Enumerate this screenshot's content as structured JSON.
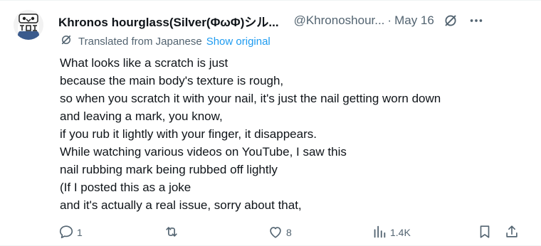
{
  "post": {
    "author_name": "Khronos hourglass(Silver(ΦωΦ)シル...",
    "author_handle": "@Khronoshour...",
    "separator": "·",
    "date": "May 16",
    "translation": {
      "label": "Translated from Japanese",
      "link": "Show original"
    },
    "lines": [
      "What looks like a scratch is just",
      "because the main body's texture is rough,",
      "so when you scratch it with your nail, it's just the nail getting worn down",
      "and leaving a mark, you know,",
      "if you rub it lightly with your finger, it disappears.",
      "While watching various videos on YouTube, I saw this",
      "nail rubbing mark being rubbed off lightly",
      "(If I posted this as a joke",
      "and it's actually a real issue, sorry about that,"
    ]
  },
  "actions": {
    "replies": "1",
    "reposts": "",
    "likes": "8",
    "views": "1.4K"
  },
  "icons": {
    "header": [
      "grok-icon",
      "more-icon"
    ],
    "translate": "grok-translate-icon",
    "actions": [
      "reply-icon",
      "repost-icon",
      "like-icon",
      "views-icon",
      "bookmark-icon",
      "share-icon"
    ]
  },
  "colors": {
    "text": "#0f1419",
    "secondary": "#536471",
    "link": "#1d9bf0",
    "divider": "#eff3f4"
  }
}
